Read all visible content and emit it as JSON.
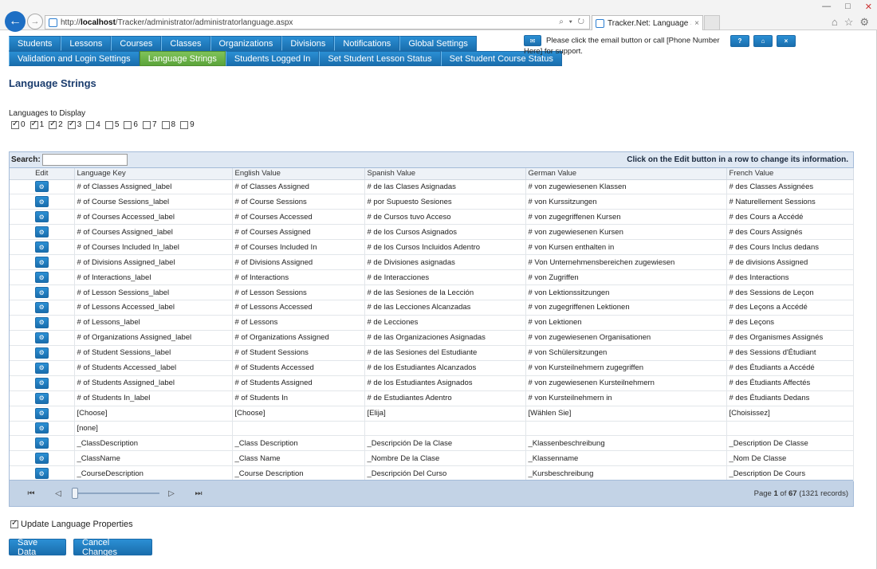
{
  "browser": {
    "url_prefix": "http://",
    "url_host": "localhost",
    "url_path": "/Tracker/administrator/administratorlanguage.aspx",
    "address_tools": "⌕ ▾ ↻",
    "tab_title": "Tracker.Net: Language Strin...",
    "tab_close": "×",
    "back": "←",
    "forward": "→",
    "window_controls": [
      "—",
      "□",
      "✕"
    ],
    "toolbar_icons": [
      "⌂",
      "☆",
      "⚙"
    ]
  },
  "menu": {
    "row1": [
      "Students",
      "Lessons",
      "Courses",
      "Classes",
      "Organizations",
      "Divisions",
      "Notifications",
      "Global Settings"
    ],
    "row2": [
      "Validation and Login Settings",
      "Language Strings",
      "Students Logged In",
      "Set Student Lesson Status",
      "Set Student Course Status"
    ],
    "active": "Language Strings"
  },
  "header": {
    "email_icon": "✉",
    "support_text": "Please click the email button or call [Phone Number Here] for support.",
    "help_label": "?",
    "home_label": "⌂",
    "logout_label": "×"
  },
  "page_title": "Language Strings",
  "languages": {
    "label": "Languages to Display",
    "options": [
      {
        "label": "0",
        "checked": true
      },
      {
        "label": "1",
        "checked": true
      },
      {
        "label": "2",
        "checked": true
      },
      {
        "label": "3",
        "checked": true
      },
      {
        "label": "4",
        "checked": false
      },
      {
        "label": "5",
        "checked": false
      },
      {
        "label": "6",
        "checked": false
      },
      {
        "label": "7",
        "checked": false
      },
      {
        "label": "8",
        "checked": false
      },
      {
        "label": "9",
        "checked": false
      }
    ]
  },
  "grid": {
    "search_label": "Search:",
    "search_value": "",
    "hint": "Click on the Edit button in a row to change its information.",
    "edit_icon": "⚙",
    "columns": [
      "Edit",
      "Language Key",
      "English Value",
      "Spanish Value",
      "German Value",
      "French Value"
    ],
    "rows": [
      [
        "# of Classes Assigned_label",
        "# of Classes Assigned",
        "# de las Clases Asignadas",
        "# von zugewiesenen Klassen",
        "# des Classes Assignées"
      ],
      [
        "# of Course Sessions_label",
        "# of Course Sessions",
        "# por Supuesto Sesiones",
        "# von Kurssitzungen",
        "# Naturellement Sessions"
      ],
      [
        "# of Courses Accessed_label",
        "# of Courses Accessed",
        "# de Cursos tuvo Acceso",
        "# von zugegriffenen Kursen",
        "# des Cours a Accédé"
      ],
      [
        "# of Courses Assigned_label",
        "# of Courses Assigned",
        "# de los Cursos Asignados",
        "# von zugewiesenen Kursen",
        "# des Cours Assignés"
      ],
      [
        "# of Courses Included In_label",
        "# of Courses Included In",
        "# de los Cursos Incluidos Adentro",
        "# von Kursen enthalten in",
        "# des Cours Inclus dedans"
      ],
      [
        "# of Divisions Assigned_label",
        "# of Divisions Assigned",
        "# de Divisiones asignadas",
        "# Von Unternehmensbereichen zugewiesen",
        "# de divisions Assigned"
      ],
      [
        "# of Interactions_label",
        "# of Interactions",
        "# de Interacciones",
        "# von Zugriffen",
        "# des Interactions"
      ],
      [
        "# of Lesson Sessions_label",
        "# of Lesson Sessions",
        "# de las Sesiones de la Lección",
        "# von Lektionssitzungen",
        "# des Sessions de Leçon"
      ],
      [
        "# of Lessons Accessed_label",
        "# of Lessons Accessed",
        "# de las Lecciones Alcanzadas",
        "# von zugegriffenen Lektionen",
        "# des Leçons a Accédé"
      ],
      [
        "# of Lessons_label",
        "# of Lessons",
        "# de Lecciones",
        "# von Lektionen",
        "# des Leçons"
      ],
      [
        "# of Organizations Assigned_label",
        "# of Organizations Assigned",
        "# de las Organizaciones Asignadas",
        "# von zugewiesenen Organisationen",
        "# des Organismes Assignés"
      ],
      [
        "# of Student Sessions_label",
        "# of Student Sessions",
        "# de las Sesiones del Estudiante",
        "# von Schülersitzungen",
        "# des Sessions d'Étudiant"
      ],
      [
        "# of Students Accessed_label",
        "# of Students Accessed",
        "# de los Estudiantes Alcanzados",
        "# von Kursteilnehmern zugegriffen",
        "# des Étudiants a Accédé"
      ],
      [
        "# of Students Assigned_label",
        "# of Students Assigned",
        "# de los Estudiantes Asignados",
        "# von zugewiesenen Kursteilnehmern",
        "# des Étudiants Affectés"
      ],
      [
        "# of Students In_label",
        "# of Students In",
        "# de Estudiantes Adentro",
        "# von Kursteilnehmern in",
        "# des Étudiants Dedans"
      ],
      [
        "[Choose]",
        "[Choose]",
        "[Elija]",
        "[Wählen Sie]",
        "[Choisissez]"
      ],
      [
        "[none]",
        "",
        "",
        "",
        ""
      ],
      [
        "_ClassDescription",
        "_Class Description",
        "_Descripción De la Clase",
        "_Klassenbeschreibung",
        "_Description De Classe"
      ],
      [
        "_ClassName",
        "_Class Name",
        "_Nombre De la Clase",
        "_Klassenname",
        "_Nom De Classe"
      ],
      [
        "_CourseDescription",
        "_Course Description",
        "_Descripción Del Curso",
        "_Kursbeschreibung",
        "_Description De Cours"
      ]
    ]
  },
  "pager": {
    "first": "⏮",
    "prev": "◁",
    "next": "▷",
    "last": "⏭",
    "page_word": "Page",
    "current_page": "1",
    "of_word": "of",
    "total_pages": "67",
    "records": "(1321 records)",
    "slider_fraction": 0
  },
  "update_label": "Update Language Properties",
  "update_checked": true,
  "buttons": {
    "save": "Save Data",
    "cancel": "Cancel Changes"
  }
}
